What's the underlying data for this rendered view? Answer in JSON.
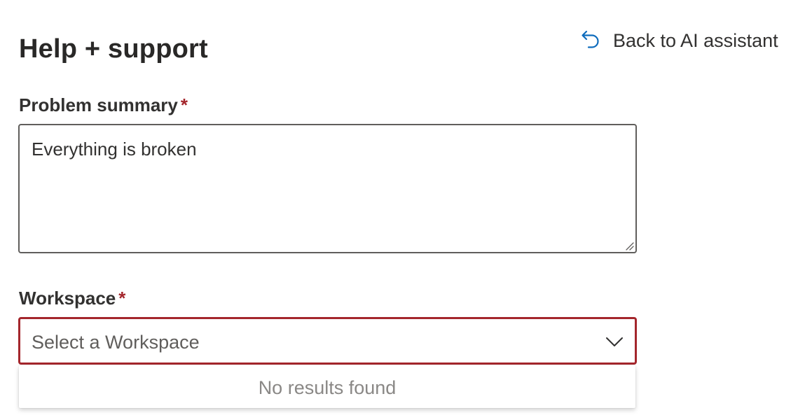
{
  "page": {
    "title": "Help + support"
  },
  "header": {
    "back_link_label": "Back to AI assistant"
  },
  "form": {
    "summary": {
      "label": "Problem summary",
      "required_marker": "*",
      "value": "Everything is broken"
    },
    "workspace": {
      "label": "Workspace",
      "required_marker": "*",
      "placeholder": "Select a Workspace",
      "empty_message": "No results found"
    }
  },
  "icons": {
    "back": "undo-arrow-icon",
    "dropdown": "chevron-down-icon",
    "resize": "resize-grip-icon"
  },
  "colors": {
    "accent_link": "#0f6cbd",
    "error_border": "#a4262c",
    "required_asterisk": "#a4262c",
    "text_primary": "#323130",
    "text_muted": "#8a8886"
  }
}
